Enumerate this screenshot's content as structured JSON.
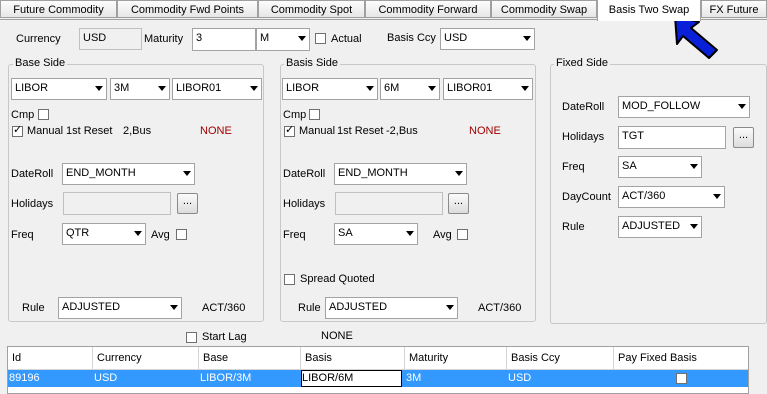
{
  "tabs": [
    {
      "label": "Future Commodity"
    },
    {
      "label": "Commodity Fwd Points"
    },
    {
      "label": "Commodity Spot"
    },
    {
      "label": "Commodity Forward"
    },
    {
      "label": "Commodity Swap"
    },
    {
      "label": "Basis Two Swap"
    },
    {
      "label": "FX Future"
    }
  ],
  "active_tab": "Basis Two Swap",
  "top": {
    "currency_label": "Currency",
    "currency_value": "USD",
    "maturity_label": "Maturity",
    "maturity_value": "3",
    "maturity_unit": "M",
    "actual_label": "Actual",
    "basis_ccy_label": "Basis Ccy",
    "basis_ccy_value": "USD"
  },
  "base_side": {
    "title": "Base Side",
    "index": "LIBOR",
    "tenor": "3M",
    "source": "LIBOR01",
    "cmp_label": "Cmp",
    "manual_label": "Manual",
    "first_reset_label": "1st Reset",
    "first_reset_value": "2,Bus",
    "none_text": "NONE",
    "dateroll_label": "DateRoll",
    "dateroll_value": "END_MONTH",
    "holidays_label": "Holidays",
    "holidays_value": "",
    "freq_label": "Freq",
    "freq_value": "QTR",
    "avg_label": "Avg",
    "rule_label": "Rule",
    "rule_value": "ADJUSTED",
    "daycount": "ACT/360",
    "ellipsis": "..."
  },
  "basis_side": {
    "title": "Basis Side",
    "index": "LIBOR",
    "tenor": "6M",
    "source": "LIBOR01",
    "cmp_label": "Cmp",
    "manual_label": "Manual",
    "first_reset_label": "1st Reset",
    "first_reset_value": "-2,Bus",
    "none_text": "NONE",
    "dateroll_label": "DateRoll",
    "dateroll_value": "END_MONTH",
    "holidays_label": "Holidays",
    "holidays_value": "",
    "freq_label": "Freq",
    "freq_value": "SA",
    "avg_label": "Avg",
    "spread_quoted_label": "Spread Quoted",
    "rule_label": "Rule",
    "rule_value": "ADJUSTED",
    "daycount": "ACT/360",
    "ellipsis": "..."
  },
  "fixed_side": {
    "title": "Fixed Side",
    "dateroll_label": "DateRoll",
    "dateroll_value": "MOD_FOLLOW",
    "holidays_label": "Holidays",
    "holidays_value": "TGT",
    "freq_label": "Freq",
    "freq_value": "SA",
    "daycount_label": "DayCount",
    "daycount_value": "ACT/360",
    "rule_label": "Rule",
    "rule_value": "ADJUSTED",
    "ellipsis": "..."
  },
  "start_lag": {
    "label": "Start Lag",
    "value": "NONE"
  },
  "grid": {
    "columns": [
      "Id",
      "Currency",
      "Base",
      "Basis",
      "Maturity",
      "Basis Ccy",
      "Pay Fixed Basis"
    ],
    "rows": [
      {
        "id": "89196",
        "currency": "USD",
        "base": "LIBOR/3M",
        "basis": "LIBOR/6M",
        "maturity": "3M",
        "basis_ccy": "USD"
      }
    ]
  },
  "colors": {
    "selection": "#3399ff",
    "none_text": "#a00000",
    "pointer_arrow": "#0a1fd8"
  },
  "icons": {
    "pointer": "big-blue-arrow-icon",
    "check": "checkmark-icon"
  }
}
